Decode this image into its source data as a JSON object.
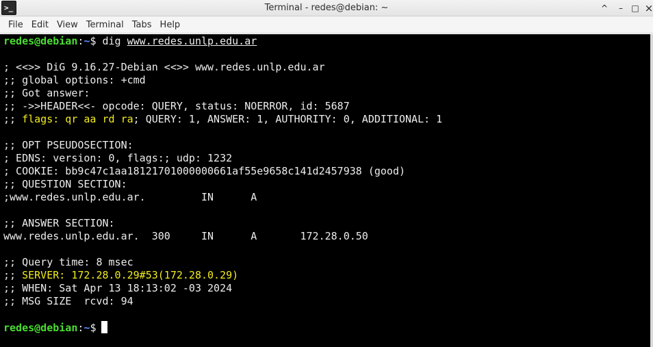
{
  "window": {
    "title": "Terminal - redes@debian: ~",
    "icon": "terminal-icon",
    "controls": {
      "collapse": "^",
      "minimize": "–",
      "maximize": "□",
      "close": "×"
    }
  },
  "menu": [
    "File",
    "Edit",
    "View",
    "Terminal",
    "Tabs",
    "Help"
  ],
  "colors": {
    "prompt_user": "#4ade32",
    "prompt_path": "#5c8cff",
    "highlight": "#f2ec1d",
    "background": "#000000",
    "text": "#ededed"
  },
  "terminal": {
    "prompt": {
      "user_host": "redes@debian",
      "colon": ":",
      "path": "~",
      "symbol": "$"
    },
    "command": " dig ",
    "command_arg": "www.redes.unlp.edu.ar",
    "output": {
      "l1": "; <<>> DiG 9.16.27-Debian <<>> www.redes.unlp.edu.ar",
      "l2": ";; global options: +cmd",
      "l3": ";; Got answer:",
      "l4": ";; ->>HEADER<<- opcode: QUERY, status: NOERROR, id: 5687",
      "l5_prefix": ";; ",
      "l5_flags": "flags: qr aa rd ra",
      "l5_rest": "; QUERY: 1, ANSWER: 1, AUTHORITY: 0, ADDITIONAL: 1",
      "l6": ";; OPT PSEUDOSECTION:",
      "l7": "; EDNS: version: 0, flags:; udp: 1232",
      "l8": "; COOKIE: bb9c47c1aa18121701000000661af55e9658c141d2457938 (good)",
      "l9": ";; QUESTION SECTION:",
      "l10": ";www.redes.unlp.edu.ar.         IN      A",
      "l11": ";; ANSWER SECTION:",
      "l12": "www.redes.unlp.edu.ar.  300     IN      A       172.28.0.50",
      "l13": ";; Query time: 8 msec",
      "l14_prefix": ";; ",
      "l14_server": "SERVER: 172.28.0.29#53(172.28.0.29)",
      "l15": ";; WHEN: Sat Apr 13 18:13:02 -03 2024",
      "l16": ";; MSG SIZE  rcvd: 94"
    }
  }
}
